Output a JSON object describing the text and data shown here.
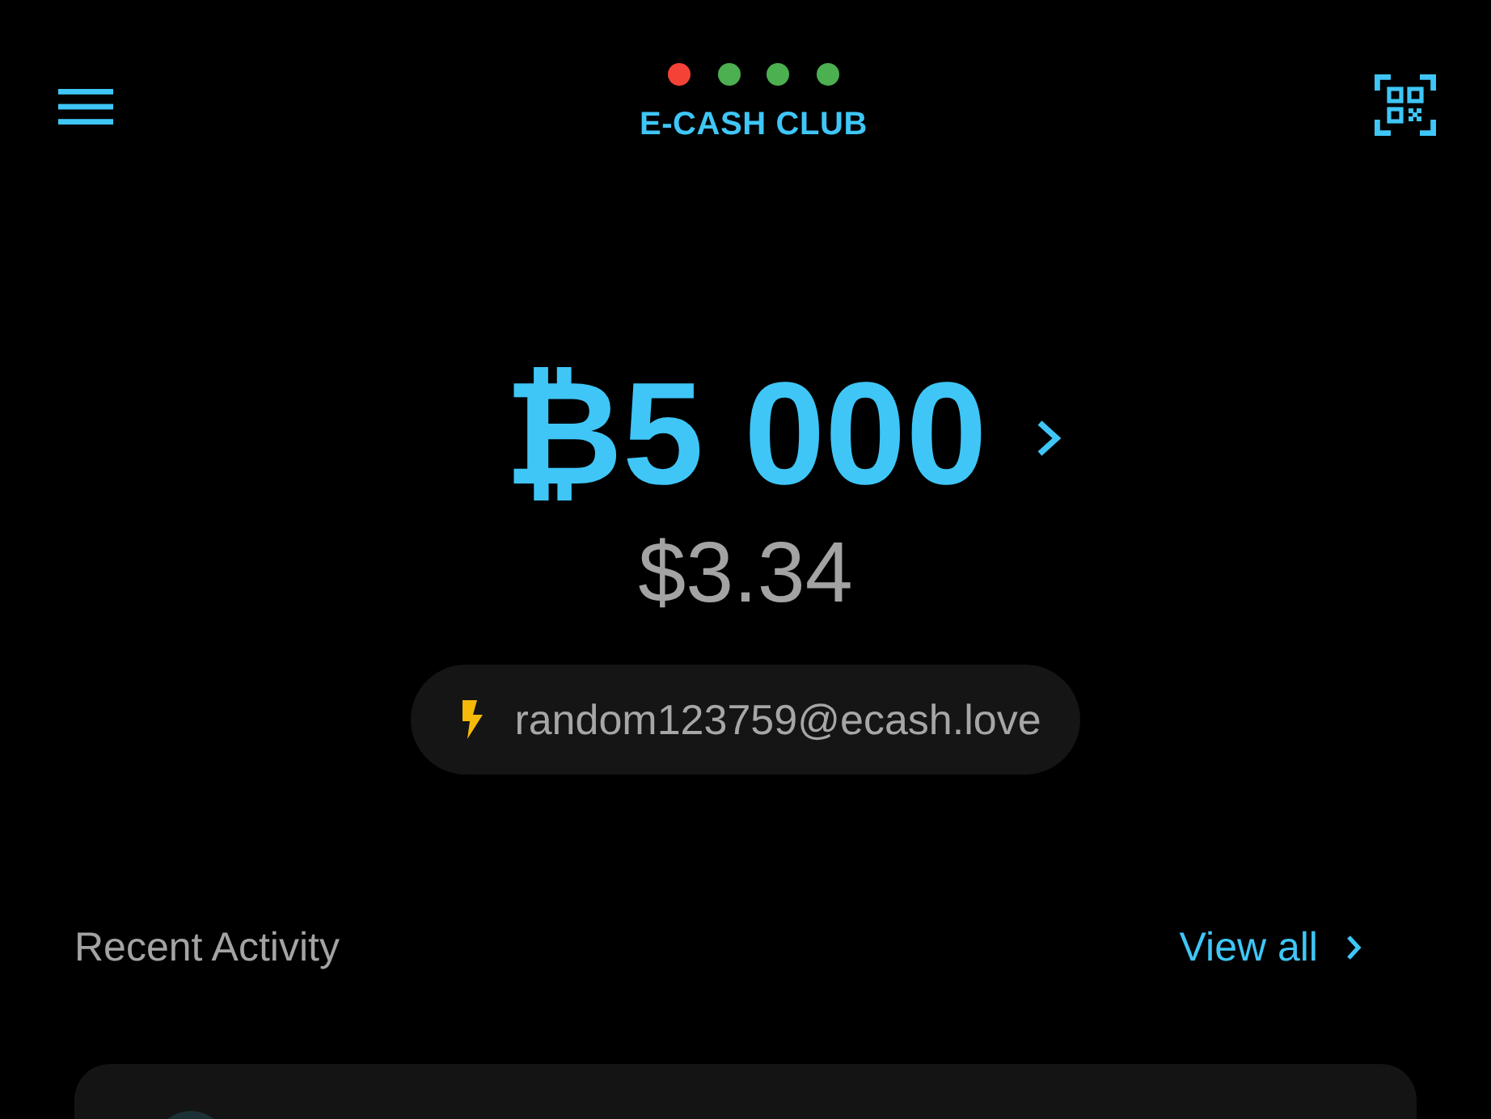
{
  "header": {
    "status_dots": [
      {
        "color": "#f44336"
      },
      {
        "color": "#4caf50"
      },
      {
        "color": "#4caf50"
      },
      {
        "color": "#4caf50"
      }
    ],
    "title": "E-CASH CLUB"
  },
  "balance": {
    "amount": "₿5 000",
    "fiat": "$3.34"
  },
  "lightning_address": "random123759@ecash.love",
  "recent_activity": {
    "heading": "Recent Activity",
    "link": "View all"
  }
}
